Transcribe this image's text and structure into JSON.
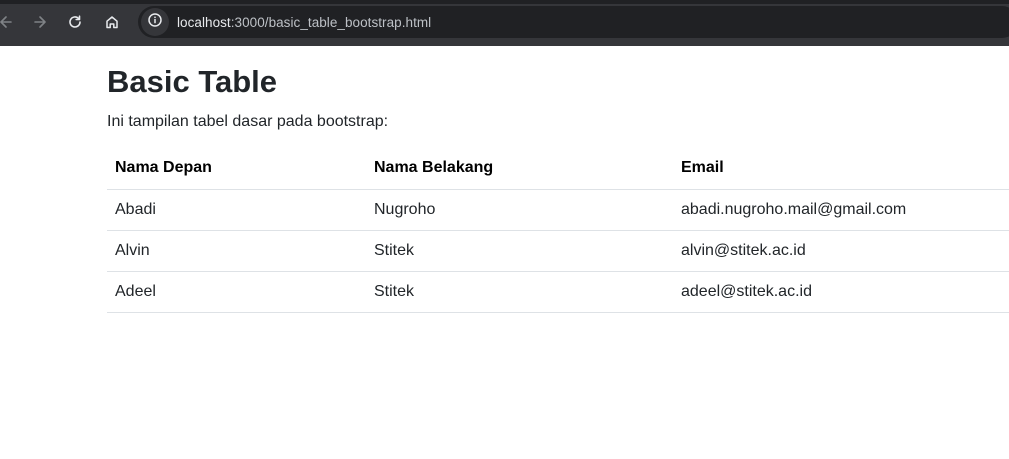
{
  "browser": {
    "url_host": "localhost",
    "url_rest": ":3000/basic_table_bootstrap.html",
    "icons": {
      "back": "arrow-left-icon",
      "forward": "arrow-right-icon",
      "reload": "reload-icon",
      "home": "home-icon",
      "site_info": "info-circle-icon"
    }
  },
  "page": {
    "title": "Basic Table",
    "description": "Ini tampilan tabel dasar pada bootstrap:"
  },
  "table": {
    "headers": [
      "Nama Depan",
      "Nama Belakang",
      "Email"
    ],
    "rows": [
      [
        "Abadi",
        "Nugroho",
        "abadi.nugroho.mail@gmail.com"
      ],
      [
        "Alvin",
        "Stitek",
        "alvin@stitek.ac.id"
      ],
      [
        "Adeel",
        "Stitek",
        "adeel@stitek.ac.id"
      ]
    ]
  },
  "colors": {
    "chrome_bg": "#35363a",
    "omnibox_bg": "#202124",
    "text": "#212529",
    "border": "#dee2e6"
  }
}
